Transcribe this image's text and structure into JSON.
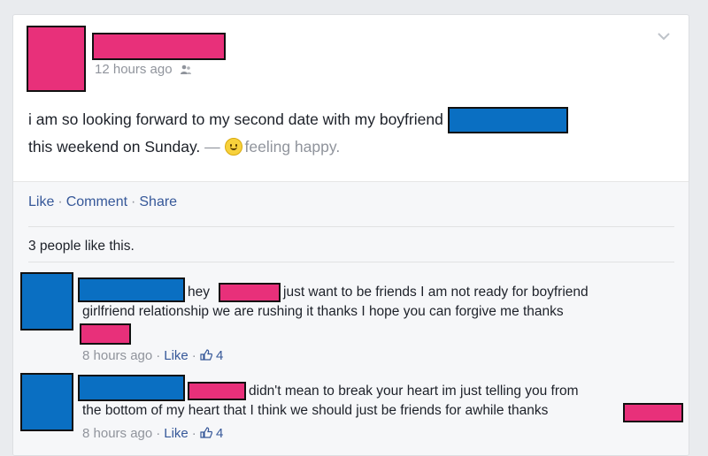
{
  "post": {
    "timestamp": "12 hours ago",
    "audience_icon": "friends-icon",
    "text_line1": "i am so looking forward to my second date with my boyfriend",
    "text_line2": "this weekend on Sunday.",
    "dash": " — ",
    "feeling": "feeling happy.",
    "menu_icon": "chevron-down-icon"
  },
  "actions": {
    "like": "Like",
    "comment": "Comment",
    "share": "Share",
    "separator": "·"
  },
  "likes_summary": "3 people like this.",
  "comments": [
    {
      "text_a": "hey",
      "text_b": "just want to be friends I am not ready for boyfriend",
      "text_c": "girlfriend relationship we are rushing it thanks I hope you can forgive me thanks",
      "time": "8 hours ago",
      "like": "Like",
      "like_count": "4"
    },
    {
      "text_a": "didn't mean to break your heart im just telling you from",
      "text_b": "the bottom of my heart that I think we should just be friends for awhile thanks",
      "time": "8 hours ago",
      "like": "Like",
      "like_count": "4"
    }
  ],
  "colors": {
    "redact_pink": "#e8307a",
    "redact_blue": "#0a6fc2",
    "link": "#365899"
  }
}
